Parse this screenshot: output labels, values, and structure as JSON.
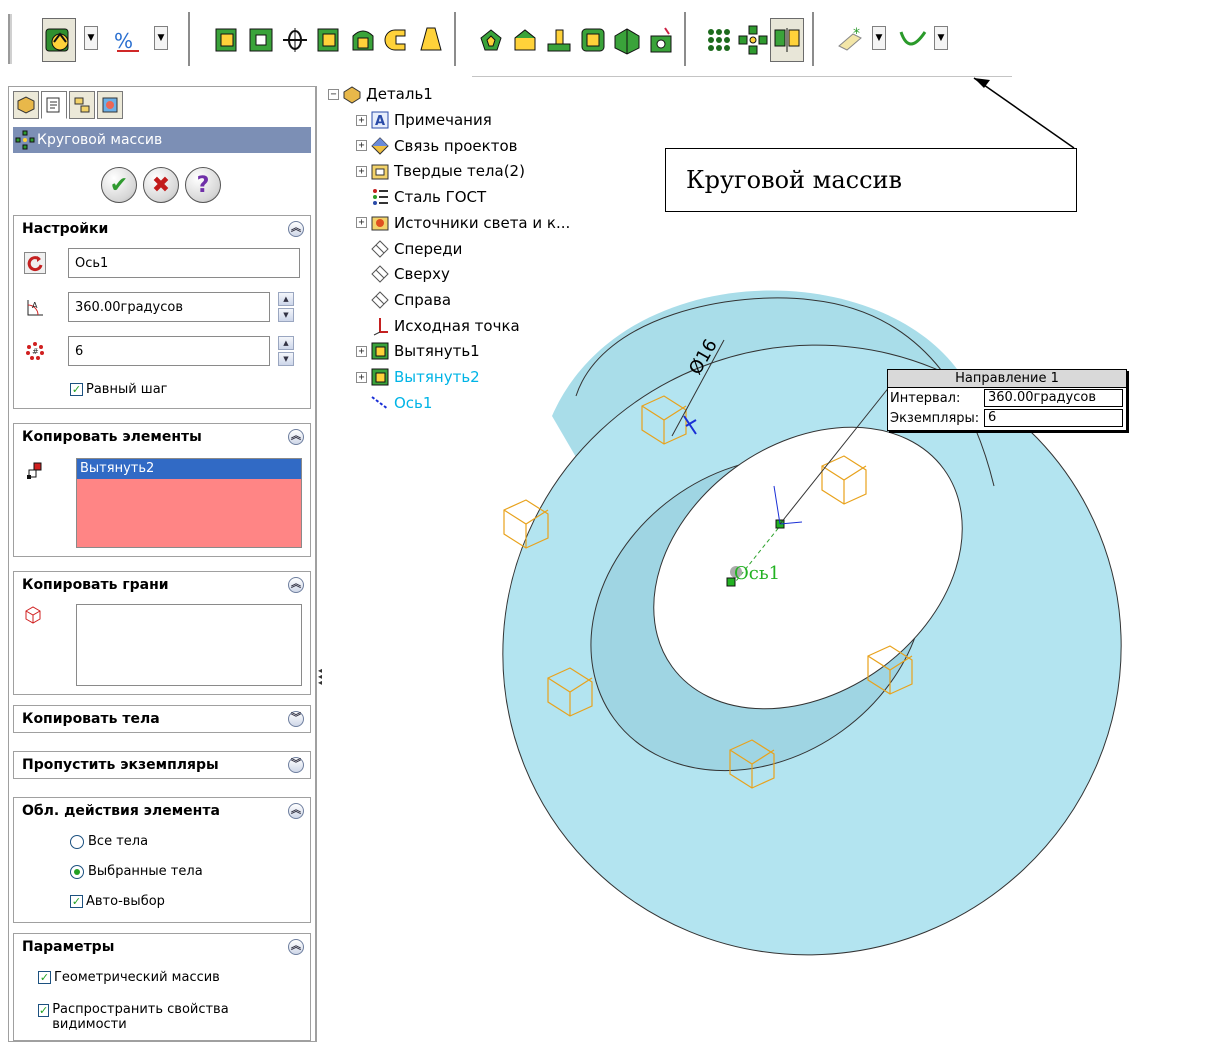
{
  "toolbar": {
    "buttons": [
      "smart-dimension-icon",
      "display-units-icon",
      "extrude-boss-icon",
      "extrude-cut-icon",
      "revolve-icon",
      "sweep-icon",
      "loft-icon",
      "fillet-icon",
      "draft-icon",
      "shell-icon",
      "chamfer-icon",
      "rib-icon",
      "wrap-icon",
      "dome-icon",
      "hole-wizard-icon",
      "linear-pattern-icon",
      "circular-pattern-icon",
      "mirror-icon",
      "reference-geometry-icon",
      "curves-icon"
    ]
  },
  "property_manager": {
    "tabs": [
      "feature-manager-tab",
      "property-manager-tab",
      "configuration-manager-tab",
      "appearance-tab"
    ],
    "title": "Круговой массив",
    "actions": {
      "ok": "✔",
      "cancel": "✖",
      "help": "?"
    },
    "settings": {
      "heading": "Настройки",
      "axis": "Ось1",
      "angle": "360.00градусов",
      "instances": "6",
      "equal_spacing": "Равный шаг"
    },
    "copy_features": {
      "heading": "Копировать элементы",
      "items": [
        "Вытянуть2"
      ]
    },
    "copy_faces": {
      "heading": "Копировать грани"
    },
    "copy_bodies": {
      "heading": "Копировать тела"
    },
    "skip_instances": {
      "heading": "Пропустить экземпляры"
    },
    "feature_scope": {
      "heading": "Обл. действия элемента",
      "all_bodies": "Все тела",
      "selected_bodies": "Выбранные тела",
      "auto_select": "Авто-выбор"
    },
    "options": {
      "heading": "Параметры",
      "geometry_pattern": "Геометрический массив",
      "propagate_visual": "Распространить свойства видимости"
    }
  },
  "tree": {
    "root": "Деталь1",
    "items": [
      {
        "label": "Примечания",
        "expandable": true,
        "icon": "annotations-icon"
      },
      {
        "label": "Связь проектов",
        "expandable": true,
        "icon": "design-binder-icon"
      },
      {
        "label": "Твердые тела(2)",
        "expandable": true,
        "icon": "solid-bodies-icon"
      },
      {
        "label": "Сталь ГОСТ",
        "expandable": false,
        "icon": "material-icon"
      },
      {
        "label": "Источники света и к...",
        "expandable": true,
        "icon": "lights-icon"
      },
      {
        "label": "Спереди",
        "expandable": false,
        "icon": "plane-icon"
      },
      {
        "label": "Сверху",
        "expandable": false,
        "icon": "plane-icon"
      },
      {
        "label": "Справа",
        "expandable": false,
        "icon": "plane-icon"
      },
      {
        "label": "Исходная точка",
        "expandable": false,
        "icon": "origin-icon"
      },
      {
        "label": "Вытянуть1",
        "expandable": true,
        "icon": "extrude-feature-icon"
      },
      {
        "label": "Вытянуть2",
        "expandable": true,
        "icon": "extrude-feature-icon",
        "highlight": true
      },
      {
        "label": "Ось1",
        "expandable": false,
        "icon": "axis-icon",
        "highlight": true
      }
    ]
  },
  "graphics": {
    "callout": "Круговой массив",
    "dimension": "Ø16",
    "axis_label": "Ось1",
    "direction_box": {
      "title": "Направление 1",
      "interval_label": "Интервал:",
      "interval_value": "360.00градусов",
      "instances_label": "Экземпляры:",
      "instances_value": "6"
    }
  },
  "colors": {
    "part_face": "#aee2ee",
    "pattern_preview": "#e8a21c",
    "title_bar": "#7c8fb5",
    "selection": "#316ac5",
    "selection_fill": "#ff8585"
  }
}
